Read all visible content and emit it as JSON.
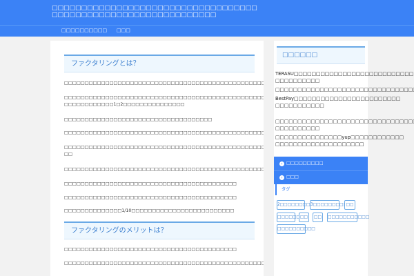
{
  "site": {
    "title_line1": "□□□□□□□□□□□□□□□□□□□□□□□□□□□□□□□□□□□",
    "title_line2": "□□□□□□□□□□□□□□□□□□□□□□□□□□□□"
  },
  "nav": {
    "items": [
      "□□□□□□□□□□",
      "□□□"
    ]
  },
  "article": {
    "h2_1": "ファクタリングとは？",
    "h2_2": "ファクタリングのメリットは？",
    "paragraphs": [
      "□□□□□□□□□□□□□□□□□□□□□□□□□□□□□□□□□□□□□□□□□□□□□□□□□□□□□□□□□□□□",
      "□□□□□□□□□□□□□□□□□□□□□□□□□□□□□□□□□□□□□□□□□□□□□□□□□□□□□□□□□□□□□□□□□□□□□□",
      "□□□□□□□□□□□□1□2□□□□□□□□□□□□□□□",
      "□□□□□□□□□□□□□□□□□□□□□□□□□□□□□□□□□□□□",
      "□□□□□□□□□□□□□□□□□□□□□□□□□□□□□□□□□□□□□□□□□□□□□□□□□□",
      "□□□□□□□□□□□□□□□□□□□□□□□□□□□□□□□□□□□□□□□□□□□□□□□□□□□□□□□□□□□□□□",
      "□□",
      "□□□□□□□□□□□□□□□□□□□□□□□□□□□□□□□□□□□□□□□□□□□□□□□□□□□□",
      "□□□□□□□□□□□□□□□□□□□□□□□□□□□□□□□□□□□□□□□□□□",
      "□□□□□□□□□□□□□□□□□□□□□□□□□□□□□□□□□□□□□□□□□□",
      "□□□□□□□□□□□□□□1/10□□□□□□□□□□□□□□□□□□□□□□□□□",
      "□□□□□□□□□□□□□□□□□□□□□□□□□□□□□□□□□□□□□□□□□□",
      "□□□□□□□□□□□□□□□□□□□□□□□□□□□□□□□□□□□□□□□□□□□□□□□□□□□□□□□□□□□"
    ]
  },
  "sidebar": {
    "heading": "□□□□□□",
    "lines": [
      "TERASU□□□□□□□□□□□□□□□□□□□□□□□□□□□",
      "□□□□□□□□□□",
      "□□□□□□□□□□□□□□□□□□□□□□□□□□□□□□□□",
      "BestPay□□□□□□□□□□□□□□□□□□□□□□□□",
      "□□□□□□□□□□□",
      "□□□□□□□□□□□□□□□□□□□□□□□□□□□□□□□□",
      "□□□□□□□□□□",
      "□□□□□□□□□□□□□□□yup□□□□□□□□□□□□",
      "□□□□□□□□□□□□□□□□□□□□"
    ],
    "nav": [
      "□□□□□□□□□",
      "□□□"
    ],
    "tag_heading": "タグ",
    "tags": [
      "2□□□□□□□□□□□",
      "3□□□□□□□□□□□",
      "□□",
      "□□□□□□",
      "□□",
      "□□",
      "□□□□□□□□□□□",
      "□□□□□□□□□□"
    ]
  }
}
